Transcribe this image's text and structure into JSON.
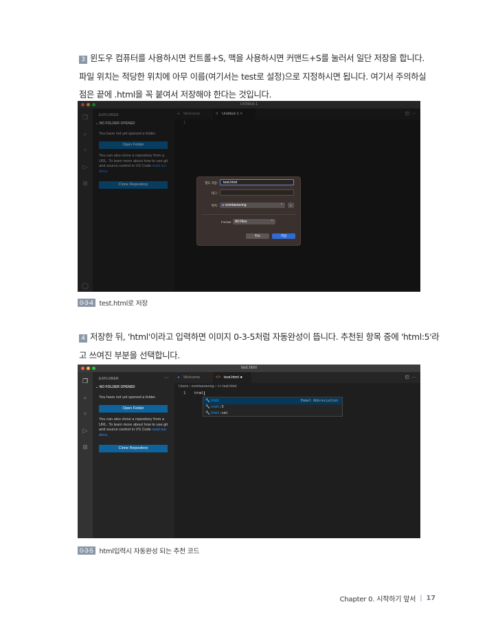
{
  "step3": {
    "number": "3",
    "line1": "윈도우 컴퓨터를 사용하시면 컨트롤+S, 맥을 사용하시면 커맨드+S를 눌러서 일단 저장을 합니다.",
    "line2": "파일 위치는 적당한 위치에 아무 이름(여기서는 test로 설정)으로 지정하시면 됩니다. 여기서 주의하실",
    "line3": "점은 끝에 .html을 꼭 붙여서 저장해야 한다는 것입니다."
  },
  "figure1": {
    "window_title": "Untitled-1",
    "sidebar": {
      "title": "EXPLORER",
      "section": "NO FOLDER OPENED",
      "text1": "You have not yet opened a folder.",
      "open_folder": "Open Folder",
      "text2": "You can also clone a repository from a URL. To learn more about how to use git and source control in VS Code",
      "text2_link": "read our docs",
      "clone_repo": "Clone Repository"
    },
    "tabs": [
      "Welcome",
      "Untitled-1"
    ],
    "line_number": "1",
    "dialog": {
      "save_as_label": "별도 저장:",
      "save_as_value": "test.html",
      "tags_label": "태그:",
      "where_label": "위치:",
      "where_value": "eomtaeseong",
      "format_label": "Format:",
      "format_value": "All Files",
      "cancel": "취소",
      "save": "저장"
    },
    "caption_tag": "0-3-4",
    "caption_text": "test.html로 저장"
  },
  "step4": {
    "number": "4",
    "line1": "저장한 뒤, 'html'이라고 입력하면 이미지 0-3-5처럼 자동완성이 뜹니다. 추천된 항목 중에 'html:5'라",
    "line2": "고 쓰여진 부분을 선택합니다."
  },
  "figure2": {
    "window_title": "test.html",
    "sidebar": {
      "title": "EXPLORER",
      "section": "NO FOLDER OPENED",
      "text1": "You have not yet opened a folder.",
      "open_folder": "Open Folder",
      "text2": "You can also clone a repository from a URL. To learn more about how to use git and source control in VS Code",
      "text2_link": "read our docs",
      "clone_repo": "Clone Repository"
    },
    "tabs": [
      "Welcome",
      "test.html"
    ],
    "breadcrumb": "Users  ›  eomtaeseong  ›  <> test.html",
    "line_number": "1",
    "typed_text": "html",
    "suggestions": [
      {
        "match": "html",
        "rest": "",
        "detail": "Emmet Abbreviation"
      },
      {
        "match": "html",
        "rest": ":5",
        "detail": ""
      },
      {
        "match": "html",
        "rest": ":xml",
        "detail": ""
      }
    ],
    "caption_tag": "0-3-5",
    "caption_text": "html입력시 자동완성 되는 추천 코드"
  },
  "footer": {
    "chapter": "Chapter 0. 시작하기 앞서",
    "page": "17"
  },
  "colors": {
    "accent": "#8a97a7",
    "vscode_button": "#0e639c",
    "vscode_bg": "#1e1e1e"
  }
}
